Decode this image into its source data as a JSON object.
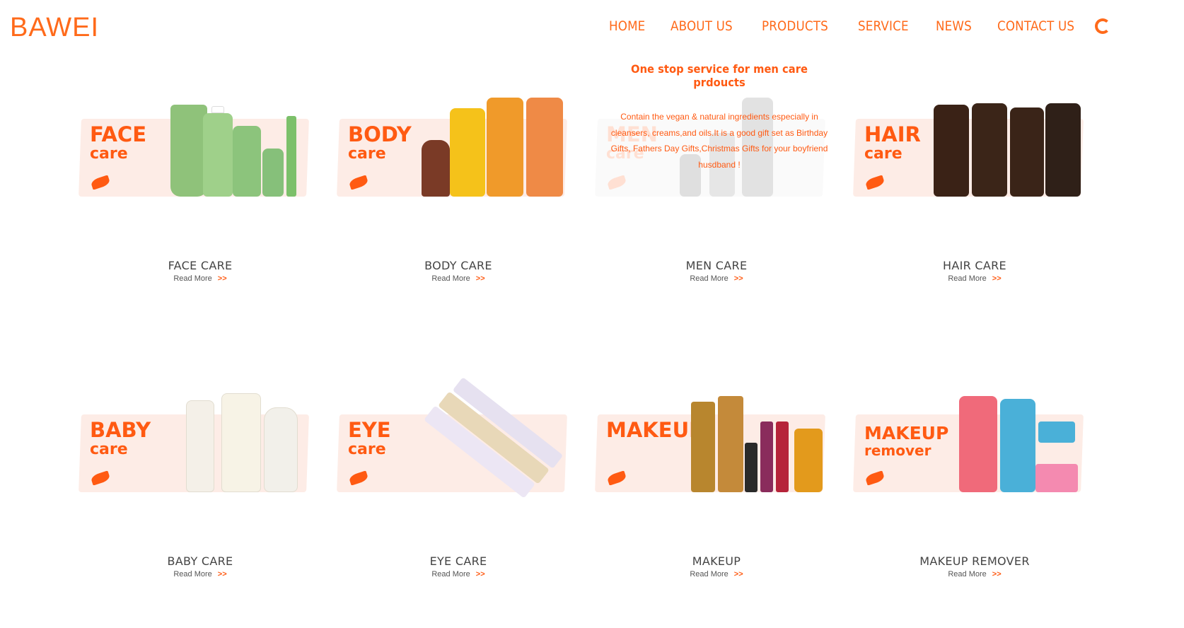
{
  "logo": "BAWEI",
  "nav": [
    "HOME",
    "ABOUT US",
    "PRODUCTS",
    "SERVICE",
    "NEWS",
    "CONTACT US"
  ],
  "overlay": {
    "title": "One stop service for men care prdoucts",
    "description": "Contain the vegan & natural ingredients especially in cleansers, creams,and oils.It is a good gift set as Birthday Gifts, Fathers Day Gifts,Christmas Gifts for your boyfriend husdband !"
  },
  "read_more": "Read More",
  "read_more_arrow": ">>",
  "products": [
    {
      "art_big": "FACE",
      "art_small": "care",
      "label": "FACE CARE",
      "colors": [
        "#8fc27a",
        "#9fd08a",
        "#8cc47c",
        "#86c07a",
        "#7cc06a"
      ]
    },
    {
      "art_big": "BODY",
      "art_small": "care",
      "label": "BODY CARE",
      "colors": [
        "#7a3a26",
        "#f5c21a",
        "#f09a2a",
        "#ef8a46"
      ]
    },
    {
      "art_big": "MEN",
      "art_small": "care",
      "label": "MEN CARE",
      "colors": [
        "#555555",
        "#777777",
        "#666666"
      ]
    },
    {
      "art_big": "HAIR",
      "art_small": "care",
      "label": "HAIR CARE",
      "colors": [
        "#3a2216",
        "#3b2518",
        "#3a2418",
        "#2f2018"
      ]
    },
    {
      "art_big": "BABY",
      "art_small": "care",
      "label": "BABY CARE",
      "colors": [
        "#f4f0e8",
        "#f7f3e6",
        "#f2f0ea"
      ]
    },
    {
      "art_big": "EYE",
      "art_small": "care",
      "label": "EYE CARE",
      "colors": [
        "#e6e1f0",
        "#e8d8b8",
        "#ece6f4"
      ]
    },
    {
      "art_big": "MAKEUP",
      "art_small": "",
      "label": "MAKEUP",
      "colors": [
        "#b8862e",
        "#c48a3a",
        "#2a2a2a",
        "#8a2c5c",
        "#b6243a",
        "#e39a1c"
      ]
    },
    {
      "art_big": "MAKEUP",
      "art_small": "remover",
      "label": "MAKEUP REMOVER",
      "colors": [
        "#f06a7a",
        "#4ab0d8",
        "#4ab0d8",
        "#f48ab0"
      ]
    }
  ]
}
